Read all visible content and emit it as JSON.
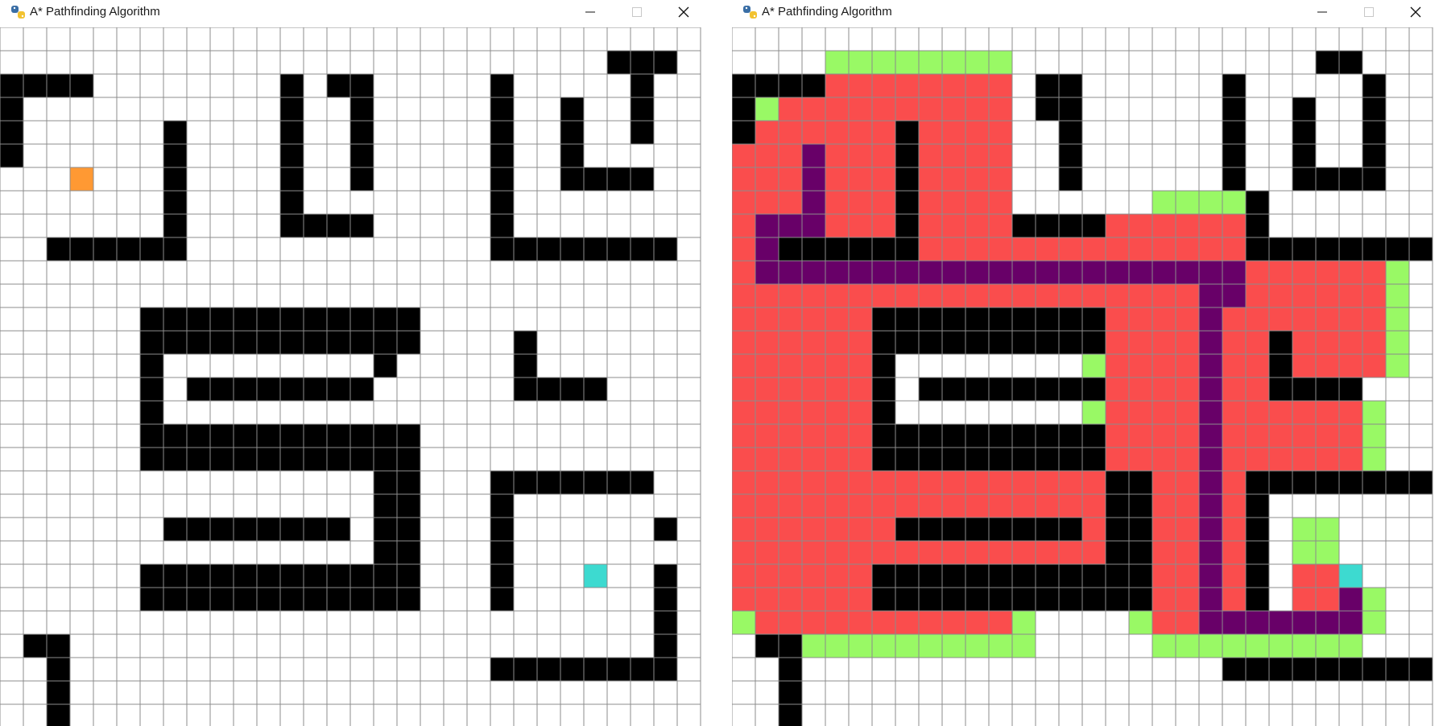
{
  "colors": {
    "empty": "#ffffff",
    "barrier": "#000000",
    "start": "#ff9933",
    "end": "#3ddad0",
    "open": "#99f965",
    "closed": "#fa4d4d",
    "path": "#680068",
    "gridline": "#8c8c8c"
  },
  "windows": [
    {
      "title": "A* Pathfinding Algorithm",
      "app_icon": "python-snake-icon",
      "controls": [
        "minimize-icon",
        "maximize-icon",
        "close-icon"
      ],
      "grid": {
        "rows": 30,
        "cols": 30,
        "legend": "B barrier, . empty, S start, E end",
        "cells": [
          "..............................",
          "..........................BBB.",
          "BBBB........B.BB.....B.....B..",
          "B...........B..B.....B..B..B..",
          "B......B....B..B.....B..B..B..",
          "B......B....B..B.....B..B.....",
          "...S...B....B..B.....B..BBBB..",
          ".......B....B........B........",
          ".......B....BBBB.....B........",
          "..BBBBBB.............BBBBBBBB.",
          "..............................",
          "..............................",
          "......BBBBBBBBBBBB............",
          "......BBBBBBBBBBBB....B.......",
          "......B.........B.....B.......",
          "......B.BBBBBBBB......BBBB....",
          "......B.......................",
          "......BBBBBBBBBBBB............",
          "......BBBBBBBBBBBB............",
          "................BB...BBBBBBB..",
          "................BB...B........",
          ".......BBBBBBBB.BB...B......B.",
          "................BB...B........",
          "......BBBBBBBBBBBB...B...E..B.",
          "......BBBBBBBBBBBB...B......B.",
          "............................B.",
          ".BB.........................B.",
          "..B..................BBBBBBBB.",
          "..B...........................",
          "..B..........................."
        ]
      }
    },
    {
      "title": "A* Pathfinding Algorithm",
      "app_icon": "python-snake-icon",
      "controls": [
        "minimize-icon",
        "maximize-icon",
        "close-icon"
      ],
      "grid": {
        "rows": 30,
        "cols": 30,
        "legend": "B barrier, . empty, E end, O open set, C closed set, P path",
        "cells": [
          "..............................",
          "....OOOOOOOO.............BB...",
          "BBBBCCCCCCCC.BB......B.....B..",
          "BOCCCCCCCCCC.BB......B..B..B..",
          "BCCCCCCBCCCC..B......B..B..B..",
          "CCCPCCCBCCCC..B......B..B..B..",
          "CCCPCCCBCCCC..B......B..BBBB..",
          "CCCPCCCBCCCC......OOOOB.......",
          "CPPPCCCBCCCCBBBBCCCCCCB.......",
          "CPBBBBBBCCCCCCCCCCCCCCBBBBBBBB",
          "CPPPPPPPPPPPPPPPPPPPPPCCCCCCO.",
          "CCCCCCCCCCCCCCCCCCCCPPCCCCCCO.",
          "CCCCCCBBBBBBBBBBCCCCPCCCCCCCO.",
          "CCCCCCBBBBBBBBBBCCCCPCCBCCCCO.",
          "CCCCCCB........OCCCCPCCBCCCCO.",
          "CCCCCCB.BBBBBBBBCCCCPCCBBBB...",
          "CCCCCCB........OCCCCPCCCCCCO..",
          "CCCCCCBBBBBBBBBBCCCCPCCCCCCO..",
          "CCCCCCBBBBBBBBBBCCCCPCCCCCCO..",
          "CCCCCCCCCCCCCCCCBBCCPCBBBBBBBB",
          "CCCCCCCCCCCCCCCCBBCCPCB.......",
          "CCCCCCCBBBBBBBBCBBCCPCB.OO....",
          "CCCCCCCCCCCCCCCCBBCCPCB.OO....",
          "CCCCCCBBBBBBBBBBBBCCPCB.CCE...",
          "CCCCCCBBBBBBBBBBBBCCPCB.CCPO..",
          "OCCCCCCCCCCCO....OCCPPPPPPPO..",
          ".BBOOOOOOOOOO.....OOOOOOOOO...",
          "..B..................BBBBBBBBB",
          "..B...........................",
          "..B..........................."
        ]
      }
    }
  ]
}
